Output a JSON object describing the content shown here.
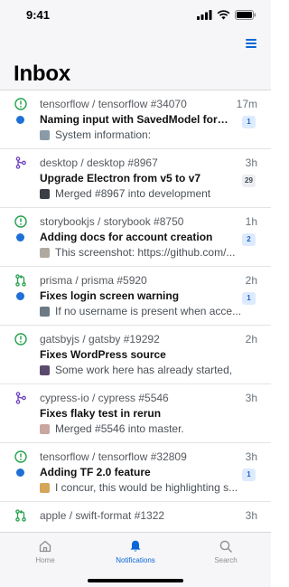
{
  "status_bar": {
    "time": "9:41"
  },
  "header": {
    "title": "Inbox",
    "menu_icon": "menu-lines-icon"
  },
  "colors": {
    "accent": "#0a66d6",
    "issue_open": "#22a04b",
    "merged": "#6f42c1",
    "unread": "#1f6fd6"
  },
  "notifications": [
    {
      "type": "issue",
      "icon": "issue-open-icon",
      "unread": true,
      "repo": "tensorflow / tensorflow #34070",
      "time": "17m",
      "title": "Naming input with SavedModel format",
      "badge": "1",
      "badge_style": "blue",
      "avatar_color": "#8a9ba8",
      "snippet": "System information:"
    },
    {
      "type": "merged",
      "icon": "git-merge-icon",
      "unread": false,
      "repo": "desktop / desktop #8967",
      "time": "3h",
      "title": "Upgrade Electron from v5 to v7",
      "badge": "29",
      "badge_style": "gray",
      "avatar_color": "#3b3f45",
      "snippet": "Merged #8967 into development"
    },
    {
      "type": "issue",
      "icon": "issue-open-icon",
      "unread": true,
      "repo": "storybookjs / storybook #8750",
      "time": "1h",
      "title": "Adding docs for account creation",
      "badge": "2",
      "badge_style": "blue",
      "avatar_color": "#b0a9a0",
      "snippet": "This screenshot: https://github.com/..."
    },
    {
      "type": "pull",
      "icon": "pull-request-icon",
      "unread": true,
      "repo": "prisma / prisma #5920",
      "time": "2h",
      "title": "Fixes login screen warning",
      "badge": "1",
      "badge_style": "blue",
      "avatar_color": "#6c7a86",
      "snippet": "If no username is present when acce..."
    },
    {
      "type": "issue",
      "icon": "issue-open-icon",
      "unread": false,
      "repo": "gatsbyjs / gatsby #19292",
      "time": "2h",
      "title": "Fixes WordPress source",
      "badge": "",
      "badge_style": "",
      "avatar_color": "#5a4a6e",
      "snippet": "Some work here has already started,"
    },
    {
      "type": "merged",
      "icon": "git-merge-icon",
      "unread": false,
      "repo": "cypress-io / cypress #5546",
      "time": "3h",
      "title": "Fixes flaky test in rerun",
      "badge": "",
      "badge_style": "",
      "avatar_color": "#c7a7a0",
      "snippet": "Merged #5546 into master."
    },
    {
      "type": "issue",
      "icon": "issue-open-icon",
      "unread": true,
      "repo": "tensorflow / tensorflow #32809",
      "time": "3h",
      "title": "Adding TF 2.0 feature",
      "badge": "1",
      "badge_style": "blue",
      "avatar_color": "#d4a55a",
      "snippet": "I concur, this would be highlighting s..."
    },
    {
      "type": "pull",
      "icon": "pull-request-icon",
      "unread": false,
      "repo": "apple / swift-format #1322",
      "time": "3h",
      "title": "",
      "badge": "",
      "badge_style": "",
      "avatar_color": "#999999",
      "snippet": ""
    }
  ],
  "tabs": [
    {
      "label": "Home",
      "icon": "home-icon",
      "active": false
    },
    {
      "label": "Notifications",
      "icon": "bell-icon",
      "active": true
    },
    {
      "label": "Search",
      "icon": "search-icon",
      "active": false
    }
  ]
}
